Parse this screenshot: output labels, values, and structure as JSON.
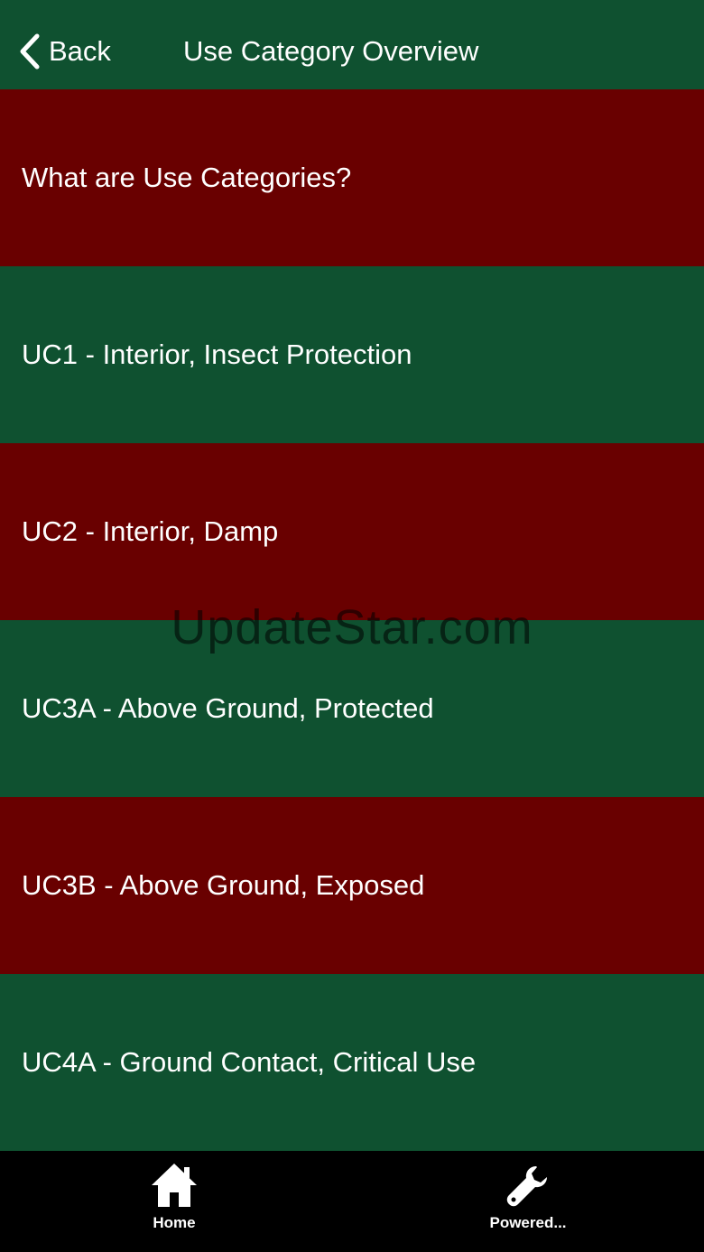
{
  "nav": {
    "back_label": "Back",
    "title": "Use Category Overview"
  },
  "items": [
    {
      "label": "What are Use Categories?",
      "color": "#690000"
    },
    {
      "label": "UC1 - Interior, Insect Protection",
      "color": "#0f5130"
    },
    {
      "label": "UC2 - Interior, Damp",
      "color": "#690000"
    },
    {
      "label": "UC3A - Above Ground, Protected",
      "color": "#0f5130"
    },
    {
      "label": "UC3B - Above Ground, Exposed",
      "color": "#690000"
    },
    {
      "label": "UC4A - Ground Contact, Critical Use",
      "color": "#0f5130"
    }
  ],
  "watermark": "UpdateStar.com",
  "tabs": [
    {
      "label": "Home",
      "icon": "home-icon"
    },
    {
      "label": "Powered...",
      "icon": "wrench-icon"
    }
  ]
}
